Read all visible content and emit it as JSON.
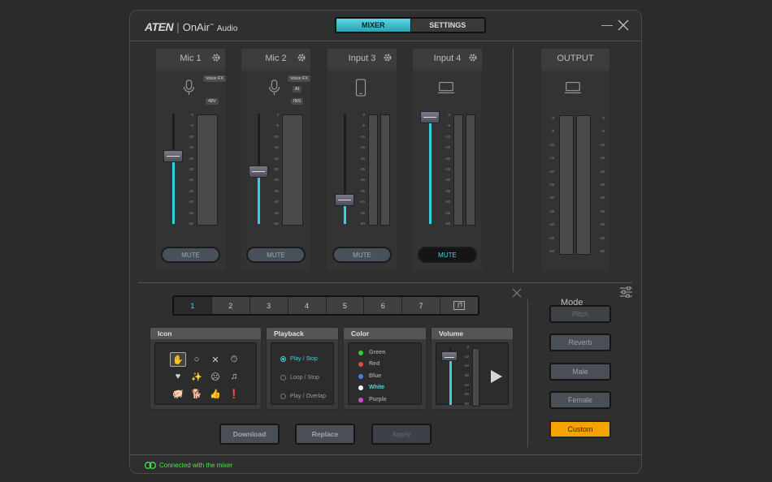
{
  "app": {
    "brand": "ATEN",
    "product": "OnAir",
    "product_suffix": "Audio",
    "tabs": [
      {
        "label": "MIXER",
        "active": true
      },
      {
        "label": "SETTINGS",
        "active": false
      }
    ]
  },
  "mixer": {
    "accent_color": "#33d1e0",
    "scale_ticks": [
      "0",
      "-5",
      "-10",
      "-15",
      "-20",
      "-25",
      "-30",
      "-35",
      "-40",
      "-45",
      "-60"
    ],
    "channels": [
      {
        "name": "Mic 1",
        "icon": "microphone-icon",
        "badges": [
          "Voice FX",
          "48V"
        ],
        "fader_percent": 62,
        "mute_label": "MUTE",
        "muted": false
      },
      {
        "name": "Mic 2",
        "icon": "microphone-icon",
        "badges": [
          "Voice FX",
          "AI",
          "INS"
        ],
        "fader_percent": 48,
        "mute_label": "MUTE",
        "muted": false
      },
      {
        "name": "Input 3",
        "icon": "phone-icon",
        "badges": [],
        "fader_percent": 22,
        "mute_label": "MUTE",
        "muted": false
      },
      {
        "name": "Input 4",
        "icon": "laptop-icon",
        "badges": [],
        "fader_percent": 97,
        "mute_label": "MUTE",
        "muted": true
      }
    ],
    "output": {
      "name": "OUTPUT",
      "icon": "laptop-icon"
    }
  },
  "pads": {
    "numbers": [
      "1",
      "2",
      "3",
      "4",
      "5",
      "6",
      "7"
    ],
    "selected": "1",
    "icon_panel": {
      "title": "Icon",
      "icons": [
        "hand-icon",
        "circle-icon",
        "x-icon",
        "timer-icon",
        "heart-icon",
        "sparkle-icon",
        "face-icon",
        "music-note-icon",
        "pig-icon",
        "dog-icon",
        "thumbs-up-icon",
        "alert-icon"
      ]
    },
    "playback_panel": {
      "title": "Playback",
      "options": [
        {
          "label": "Play / Stop",
          "selected": true
        },
        {
          "label": "Loop / Stop",
          "selected": false
        },
        {
          "label": "Play / Overlap",
          "selected": false
        }
      ]
    },
    "color_panel": {
      "title": "Color",
      "options": [
        {
          "label": "Green",
          "color": "#2fd12f",
          "selected": false
        },
        {
          "label": "Red",
          "color": "#e04848",
          "selected": false
        },
        {
          "label": "Blue",
          "color": "#5a72e8",
          "selected": false
        },
        {
          "label": "White",
          "color": "#ffffff",
          "selected": true
        },
        {
          "label": "Purple",
          "color": "#d24ad8",
          "selected": false
        }
      ]
    },
    "volume_panel": {
      "title": "Volume",
      "ticks": [
        "0",
        "-10",
        "-20",
        "-30",
        "-40",
        "-50",
        "-60"
      ],
      "fader_percent": 85
    },
    "actions": {
      "download": "Download",
      "replace": "Replace",
      "apply": "Apply"
    }
  },
  "mode": {
    "title": "Mode",
    "options": [
      {
        "label": "Pitch",
        "state": "disabled"
      },
      {
        "label": "Reverb",
        "state": "normal"
      },
      {
        "label": "Male",
        "state": "normal"
      },
      {
        "label": "Female",
        "state": "normal"
      },
      {
        "label": "Custom",
        "state": "active"
      }
    ],
    "active_color": "#f5a100"
  },
  "status": {
    "text": "Connected with the mixer",
    "color": "#4ee04e"
  }
}
